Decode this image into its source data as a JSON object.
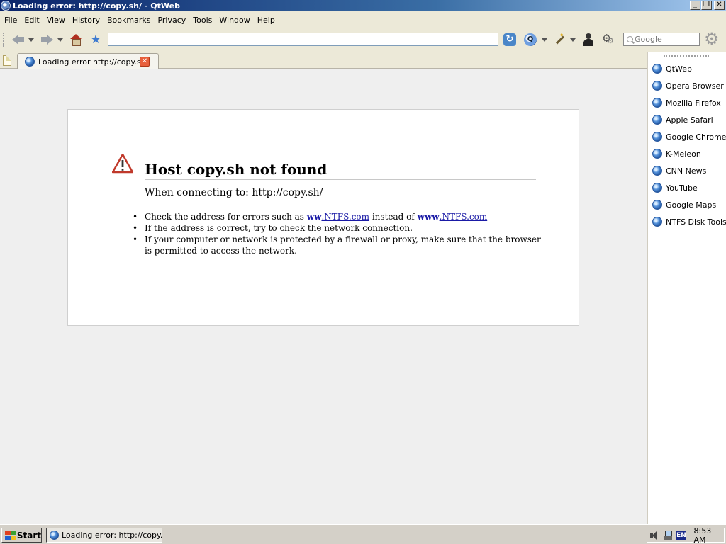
{
  "window": {
    "title": "Loading error: http://copy.sh/ - QtWeb",
    "minimize": "_",
    "restore": "❐",
    "close": "✕"
  },
  "menu": [
    "File",
    "Edit",
    "View",
    "History",
    "Bookmarks",
    "Privacy",
    "Tools",
    "Window",
    "Help"
  ],
  "toolbar": {
    "address_value": "",
    "search_placeholder": "Google"
  },
  "tab": {
    "label": "Loading error  http://copy.sh/",
    "close": "✕"
  },
  "error": {
    "title": "Host copy.sh not found",
    "subtitle": "When connecting to: http://copy.sh/",
    "tip1_prefix": "Check the address for errors such as ",
    "tip1_bad_bold": "ww",
    "tip1_bad_link": ".NTFS.com",
    "tip1_middle": " instead of ",
    "tip1_good_bold": "www",
    "tip1_good_link": ".NTFS.com",
    "tip2": "If the address is correct, try to check the network connection.",
    "tip3": "If your computer or network is protected by a firewall or proxy, make sure that the browser is permitted to access the network."
  },
  "sidebar": {
    "items": [
      {
        "label": "QtWeb"
      },
      {
        "label": "Opera Browser"
      },
      {
        "label": "Mozilla Firefox"
      },
      {
        "label": "Apple Safari"
      },
      {
        "label": "Google Chrome"
      },
      {
        "label": "K-Meleon"
      },
      {
        "label": "CNN News"
      },
      {
        "label": "YouTube"
      },
      {
        "label": "Google Maps"
      },
      {
        "label": "NTFS Disk Tools"
      }
    ]
  },
  "taskbar": {
    "start": "Start",
    "task": "Loading error: http://copy.s...",
    "lang": "EN",
    "clock": "8:53 AM"
  },
  "colors": {
    "titlebar": "#0a246a",
    "link": "#1a1aa6",
    "warning": "#c0392b"
  }
}
